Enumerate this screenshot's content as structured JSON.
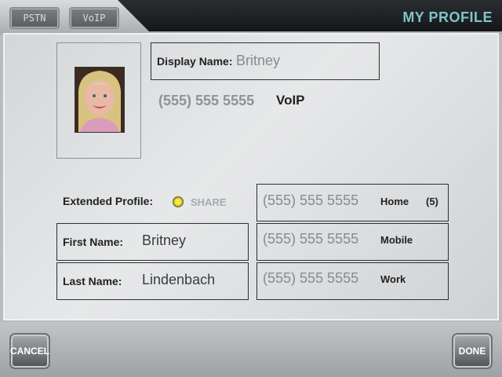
{
  "header": {
    "title": "MY PROFILE",
    "pstn_label": "PSTN",
    "voip_label": "VoIP"
  },
  "profile": {
    "display_name_label": "Display Name:",
    "display_name_value": "Britney",
    "primary_number": "(555) 555 5555",
    "primary_type": "VoIP",
    "extended_profile_label": "Extended Profile:",
    "share_label": "SHARE",
    "first_name_label": "First Name:",
    "first_name_value": "Britney",
    "last_name_label": "Last Name:",
    "last_name_value": "Lindenbach",
    "numbers": [
      {
        "number": "(555) 555 5555",
        "type": "Home",
        "count": "(5)"
      },
      {
        "number": "(555) 555 5555",
        "type": "Mobile"
      },
      {
        "number": "(555) 555 5555",
        "type": "Work"
      }
    ]
  },
  "footer": {
    "cancel_label": "CANCEL",
    "done_label": "DONE"
  },
  "colors": {
    "title": "#7fc3cb",
    "share_indicator": "#f6e94a"
  }
}
